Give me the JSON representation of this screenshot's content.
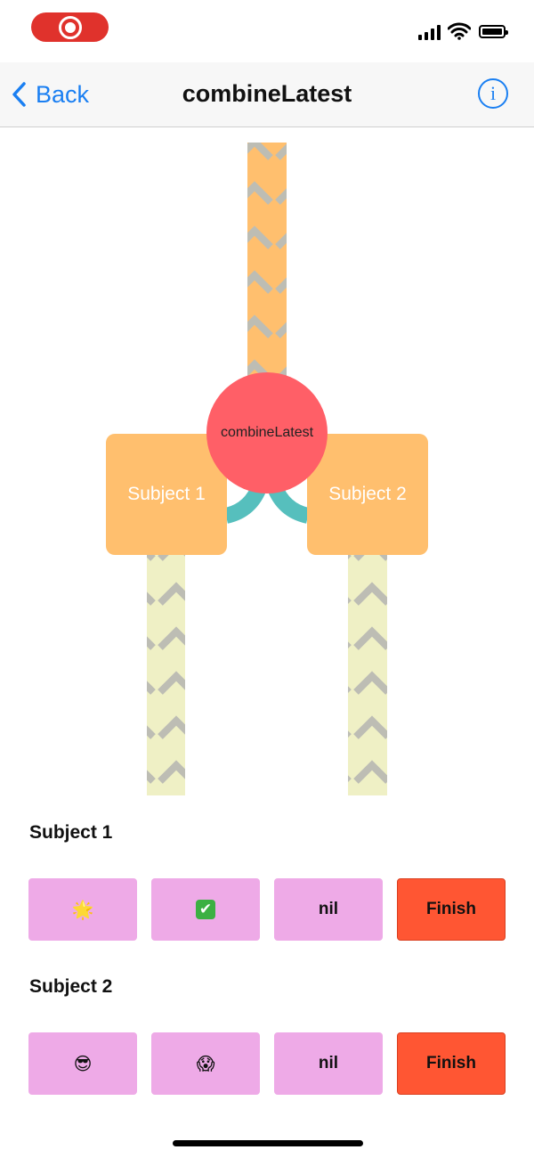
{
  "nav": {
    "back_label": "Back",
    "title": "combineLatest",
    "info_glyph": "i"
  },
  "diagram": {
    "operator_label": "combineLatest",
    "subject1_label": "Subject 1",
    "subject2_label": "Subject 2",
    "colors": {
      "subject_box": "#ffbf6e",
      "operator_circle": "#ff5f67",
      "output_stream": "#ffbf6e",
      "input_stream": "#eff0c5",
      "connector": "#56bfbd",
      "chevrons": "#bdbdb4"
    }
  },
  "controls": {
    "subject1": {
      "title": "Subject 1",
      "buttons": [
        {
          "label": "🌟",
          "icon": "glowing-star-emoji"
        },
        {
          "label": "✔",
          "icon": "check-mark-emoji"
        },
        {
          "label": "nil"
        },
        {
          "label": "Finish"
        }
      ]
    },
    "subject2": {
      "title": "Subject 2",
      "buttons": [
        {
          "label": "😎",
          "icon": "sunglasses-face-emoji"
        },
        {
          "label": "😱",
          "icon": "screaming-face-emoji"
        },
        {
          "label": "nil"
        },
        {
          "label": "Finish"
        }
      ]
    }
  },
  "colors": {
    "accent": "#1a7ff2",
    "button_value": "#eeaae7",
    "button_finish": "#ff5633",
    "record_indicator": "#e0322c"
  }
}
